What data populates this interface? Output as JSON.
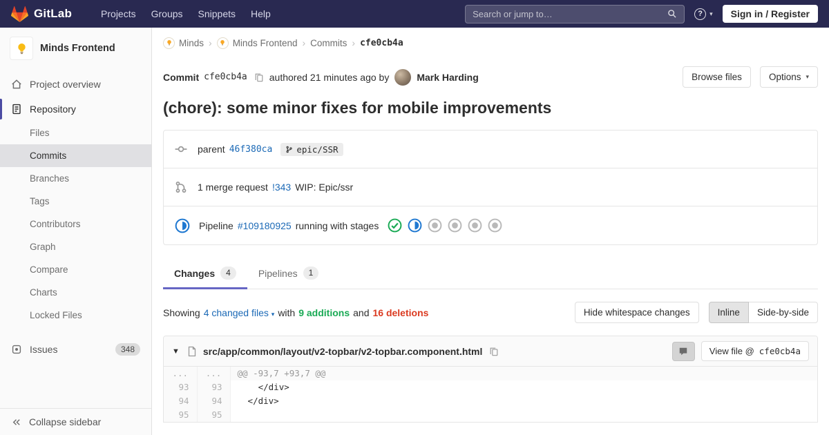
{
  "colors": {
    "navbar_bg": "#292951",
    "link": "#1b69b6",
    "accent": "#6666c4",
    "success": "#1aaa55",
    "danger": "#db3b21",
    "running": "#1f78d1"
  },
  "navbar": {
    "brand": "GitLab",
    "links": [
      "Projects",
      "Groups",
      "Snippets",
      "Help"
    ],
    "search_placeholder": "Search or jump to…",
    "help_glyph": "?",
    "sign_in": "Sign in / Register"
  },
  "sidebar": {
    "project_name": "Minds Frontend",
    "project_overview": "Project overview",
    "repository": "Repository",
    "repo_items": [
      "Files",
      "Commits",
      "Branches",
      "Tags",
      "Contributors",
      "Graph",
      "Compare",
      "Charts",
      "Locked Files"
    ],
    "active_repo_item": "Commits",
    "issues": "Issues",
    "issues_count": "348",
    "collapse": "Collapse sidebar"
  },
  "breadcrumb": {
    "group": "Minds",
    "project": "Minds Frontend",
    "section": "Commits",
    "current": "cfe0cb4a"
  },
  "commit": {
    "label": "Commit",
    "sha": "cfe0cb4a",
    "authored": "authored 21 minutes ago by",
    "author": "Mark Harding",
    "browse_files": "Browse files",
    "options": "Options",
    "title": "(chore): some minor fixes for mobile improvements",
    "parent": {
      "label": "parent",
      "sha": "46f380ca",
      "ref": "epic/SSR"
    },
    "merge_request": {
      "text": "1 merge request",
      "link": "!343",
      "title": "WIP: Epic/ssr"
    },
    "pipeline": {
      "label": "Pipeline",
      "id": "#109180925",
      "status": "running with stages",
      "stages": [
        "success",
        "running",
        "created",
        "created",
        "created",
        "created"
      ]
    }
  },
  "tabs": {
    "changes": {
      "label": "Changes",
      "count": "4"
    },
    "pipelines": {
      "label": "Pipelines",
      "count": "1"
    }
  },
  "summary": {
    "showing": "Showing",
    "changed_files": "4 changed files",
    "with": "with",
    "additions": "9 additions",
    "and": "and",
    "deletions": "16 deletions",
    "hide_whitespace": "Hide whitespace changes",
    "inline": "Inline",
    "side_by_side": "Side-by-side"
  },
  "file_diff": {
    "path": "src/app/common/layout/v2-topbar/v2-topbar.component.html",
    "view_file": "View file @",
    "view_sha": "cfe0cb4a",
    "lines": [
      {
        "old": "...",
        "new": "...",
        "code": "@@ -93,7 +93,7 @@",
        "type": "match"
      },
      {
        "old": "93",
        "new": "93",
        "code": "    </div>",
        "type": "context"
      },
      {
        "old": "94",
        "new": "94",
        "code": "  </div>",
        "type": "context"
      },
      {
        "old": "95",
        "new": "95",
        "code": "",
        "type": "context"
      }
    ]
  }
}
